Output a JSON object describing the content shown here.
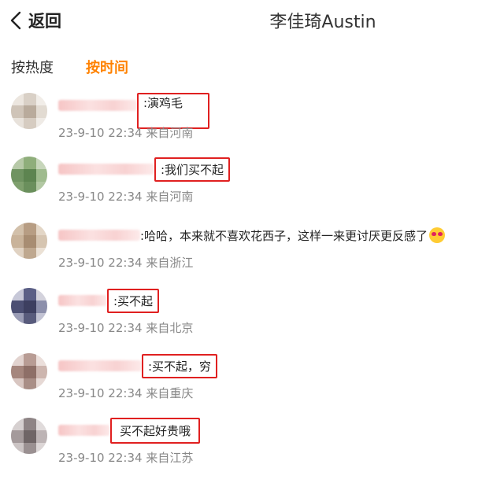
{
  "header": {
    "back_label": "返回",
    "title": "李佳琦Austin"
  },
  "tabs": [
    {
      "label": "按热度",
      "active": false
    },
    {
      "label": "按时间",
      "active": true
    }
  ],
  "accent_color": "#ff8200",
  "highlight_color": "#e02020",
  "comments": [
    {
      "text": ":演鸡毛",
      "time": "23-9-10 22:34",
      "location": "来自河南"
    },
    {
      "text": ":我们买不起",
      "time": "23-9-10 22:34",
      "location": "来自河南"
    },
    {
      "text": ":哈哈，本来就不喜欢花西子，这样一来更讨厌更反感了",
      "time": "23-9-10 22:34",
      "location": "来自浙江"
    },
    {
      "text": ":买不起",
      "time": "23-9-10 22:34",
      "location": "来自北京"
    },
    {
      "text": ":买不起，穷",
      "time": "23-9-10 22:34",
      "location": "来自重庆"
    },
    {
      "text": "买不起好贵哦",
      "time": "23-9-10 22:34",
      "location": "来自江苏"
    }
  ]
}
